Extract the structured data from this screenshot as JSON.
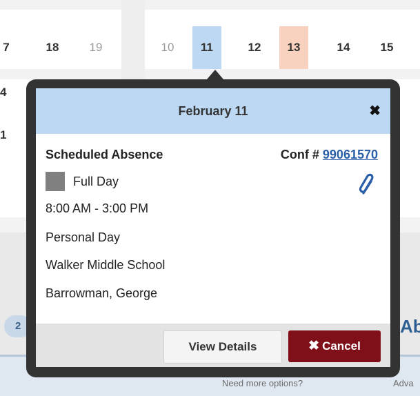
{
  "calendar": {
    "left_days": [
      {
        "label": "7",
        "muted": false
      },
      {
        "label": "18",
        "muted": false
      },
      {
        "label": "19",
        "muted": true
      }
    ],
    "right_days": [
      {
        "label": "10",
        "muted": true
      },
      {
        "label": "11",
        "muted": false,
        "state": "selected"
      },
      {
        "label": "12",
        "muted": false
      },
      {
        "label": "13",
        "muted": false,
        "state": "today"
      },
      {
        "label": "14",
        "muted": false
      },
      {
        "label": "15",
        "muted": false
      }
    ],
    "row_fragments": [
      "4",
      "1"
    ],
    "pill_fragment": "2",
    "right_heading_fragment": "Ab",
    "footer_left": "Need more options?",
    "footer_right": "Adva"
  },
  "popup": {
    "title": "February 11",
    "close_glyph": "✖",
    "absence_title": "Scheduled Absence",
    "conf_label": "Conf #",
    "conf_number": "99061570",
    "duration_label": "Full Day",
    "time_range": "8:00 AM - 3:00 PM",
    "reason": "Personal Day",
    "location": "Walker Middle School",
    "employee": "Barrowman, George",
    "view_details_label": "View Details",
    "cancel_label": "Cancel",
    "cancel_glyph": "✖"
  },
  "icons": {
    "close": "close-icon",
    "attachment": "paperclip-icon",
    "cancel": "x-icon"
  },
  "colors": {
    "header_bg": "#bcd8f2",
    "selected_day": "#bcd8f2",
    "today_day": "#f9d2bf",
    "cancel_button": "#7f0f18",
    "link": "#2b5ea8"
  }
}
